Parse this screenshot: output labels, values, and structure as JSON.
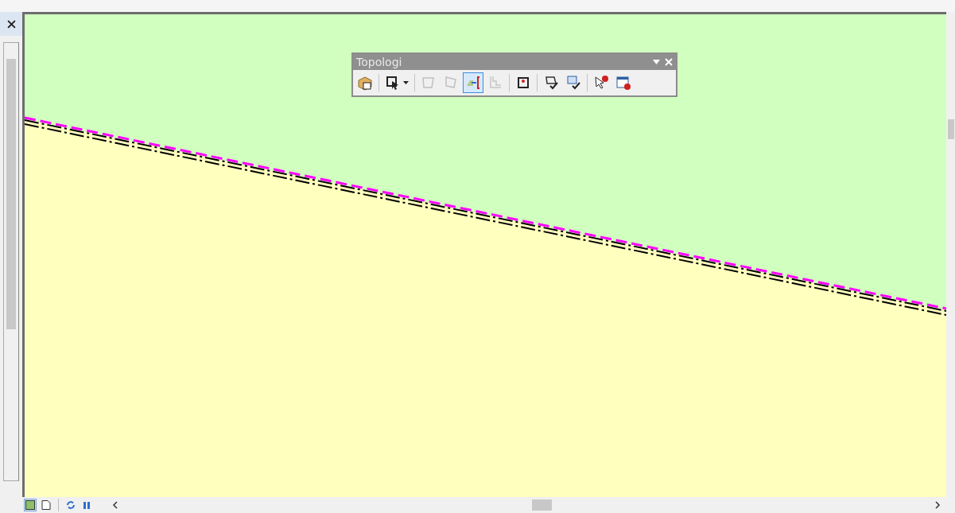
{
  "toolbar": {
    "title": "Topologi",
    "tools": [
      {
        "kind": "button",
        "disabled": false,
        "selected": false
      },
      {
        "kind": "separator"
      },
      {
        "kind": "dropdown",
        "disabled": false,
        "selected": false
      },
      {
        "kind": "separator"
      },
      {
        "kind": "button",
        "disabled": true,
        "selected": false
      },
      {
        "kind": "button",
        "disabled": true,
        "selected": false
      },
      {
        "kind": "button",
        "disabled": false,
        "selected": true
      },
      {
        "kind": "button",
        "disabled": true,
        "selected": false
      },
      {
        "kind": "separator"
      },
      {
        "kind": "button",
        "disabled": false,
        "selected": false
      },
      {
        "kind": "separator"
      },
      {
        "kind": "button",
        "disabled": false,
        "selected": false
      },
      {
        "kind": "button",
        "disabled": false,
        "selected": false
      },
      {
        "kind": "separator"
      },
      {
        "kind": "button",
        "disabled": false,
        "selected": false
      },
      {
        "kind": "button",
        "disabled": false,
        "selected": false
      }
    ]
  },
  "view_buttons": [
    {
      "selected": true
    },
    {
      "selected": false
    }
  ]
}
